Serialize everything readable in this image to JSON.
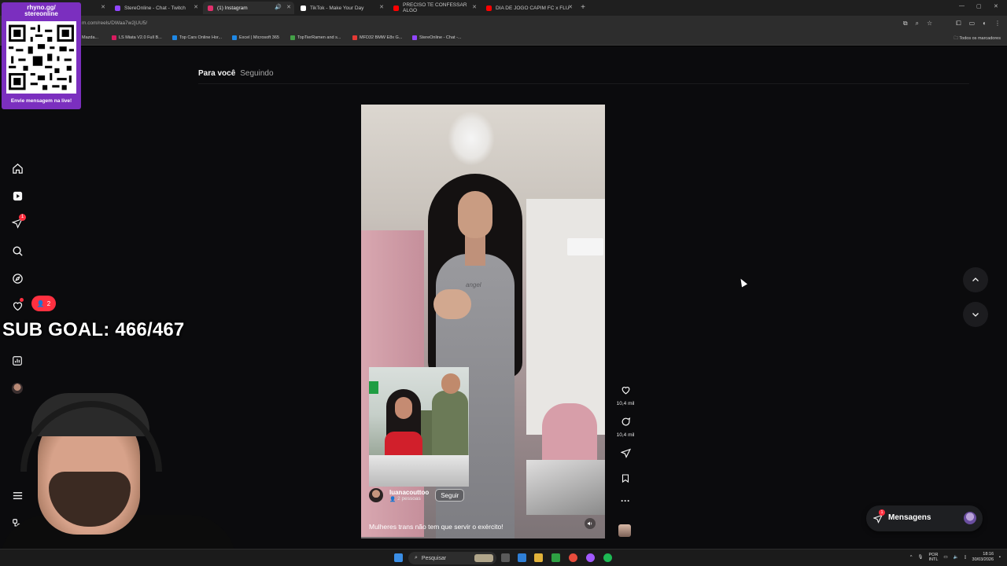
{
  "browser": {
    "tabs": [
      {
        "label": "be",
        "favicon_color": "#e53935"
      },
      {
        "label": "StereOnline - Chat - Twitch",
        "favicon_color": "#9146ff"
      },
      {
        "label": "(1) Instagram",
        "favicon_color": "#e1306c"
      },
      {
        "label": "TikTok - Make Your Day",
        "favicon_color": "#ffffff"
      },
      {
        "label": "PRECISO TE CONFESSAR ALGO",
        "favicon_color": "#ff0000"
      },
      {
        "label": "DIA DE JOGO CAPIM FC x FLU",
        "favicon_color": "#ff0000"
      }
    ],
    "url": "m.com/reels/DWaa7w2jUU5/",
    "bookmarks": [
      {
        "label": "Mazda...",
        "color": "#c0392b"
      },
      {
        "label": "LS Miata V2.0 Full B...",
        "color": "#d81b60"
      },
      {
        "label": "Top Cars Online Hor...",
        "color": "#1e88e5"
      },
      {
        "label": "Excel | Microsoft 365",
        "color": "#1e88e5"
      },
      {
        "label": "TopTierRamen and s...",
        "color": "#43a047"
      },
      {
        "label": "MFD32 BMW E8x G...",
        "color": "#e53935"
      },
      {
        "label": "StereOnline - Chat -...",
        "color": "#9146ff"
      }
    ],
    "all_bookmarks": "Todos os marcadores"
  },
  "feed_tabs": {
    "for_you": "Para você",
    "following": "Seguindo"
  },
  "sidebar": {
    "items": [
      "home-icon",
      "reels-icon",
      "direct-icon",
      "search-icon",
      "explore-icon",
      "notifications-icon",
      "insights-icon",
      "profile-avatar",
      "menu-icon",
      "meta-icon"
    ],
    "direct_badge": "1",
    "notification_count": "2"
  },
  "reel": {
    "owner": "luanacouttoo",
    "sub": "2 pessoas",
    "follow_label": "Seguir",
    "caption": "Mulheres trans não tem que servir o exército!",
    "shirt_text": "angel"
  },
  "actions": {
    "likes": "10,4 mil",
    "comments": "10,4 mil"
  },
  "messages": {
    "label": "Mensagens",
    "badge": "1"
  },
  "overlay": {
    "qr_title_1": "rhyno.gg/",
    "qr_title_2": "stereonline",
    "qr_footer": "Envie mensagem na live!",
    "sub_goal": "SUB GOAL: 466/467"
  },
  "taskbar": {
    "search_placeholder": "Pesquisar",
    "lang_1": "POR",
    "lang_2": "INTL",
    "time": "18:16",
    "date": "30/03/2026"
  }
}
